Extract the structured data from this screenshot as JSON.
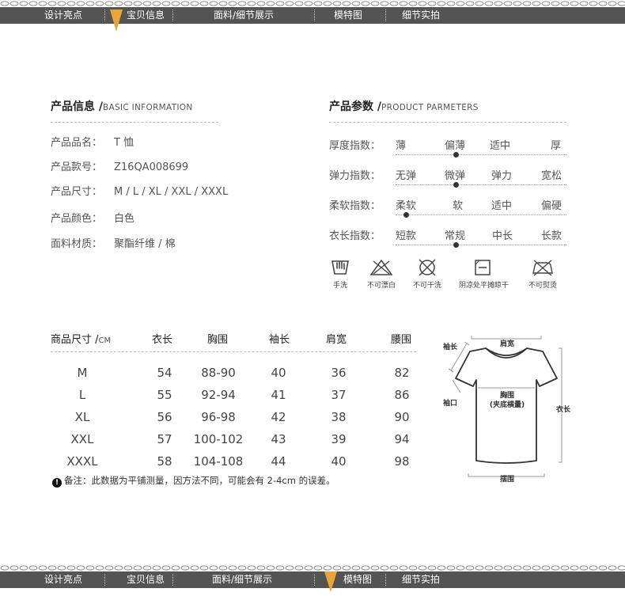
{
  "nav": {
    "items": [
      "设计亮点",
      "宝贝信息",
      "面料/细节展示",
      "模特图",
      "细节实拍"
    ],
    "top_active": 1,
    "bottom_active": 3,
    "colors": {
      "bar": "#545454",
      "arrow": "#e9a53a"
    }
  },
  "product_info": {
    "title": "产品信息 /",
    "title_en": "BASIC INFORMATION",
    "rows": [
      {
        "label": "产品品名：",
        "value": "T 恤"
      },
      {
        "label": "产品款号：",
        "value": "Z16QA008699"
      },
      {
        "label": "产品尺寸：",
        "value": "M / L / XL / XXL / XXXL"
      },
      {
        "label": "产品颜色：",
        "value": "白色"
      },
      {
        "label": "面料材质：",
        "value": "聚酯纤维 / 棉"
      }
    ]
  },
  "product_params": {
    "title": "产品参数 /",
    "title_en": "PRODUCT PARMETERS",
    "rows": [
      {
        "label": "厚度指数：",
        "options": [
          "薄",
          "偏薄",
          "适中",
          "厚"
        ],
        "selected_fraction": 0.35
      },
      {
        "label": "弹力指数：",
        "options": [
          "无弹",
          "微弹",
          "弹力",
          "宽松"
        ],
        "selected_fraction": 0.35
      },
      {
        "label": "柔软指数：",
        "options": [
          "柔软",
          "软",
          "适中",
          "偏硬"
        ],
        "selected_fraction": 0.06
      },
      {
        "label": "衣长指数：",
        "options": [
          "短款",
          "常规",
          "中长",
          "长款"
        ],
        "selected_fraction": 0.35
      }
    ],
    "care": [
      {
        "icon": "hand-wash-icon",
        "label": "手洗"
      },
      {
        "icon": "no-bleach-icon",
        "label": "不可漂白"
      },
      {
        "icon": "no-dry-clean-icon",
        "label": "不可干洗"
      },
      {
        "icon": "shade-dry-flat-icon",
        "label": "阴凉处平摊晾干"
      },
      {
        "icon": "no-iron-icon",
        "label": "不可熨烫"
      }
    ]
  },
  "size_table": {
    "headers": [
      "商品尺寸 /",
      "衣长",
      "胸围",
      "袖长",
      "肩宽",
      "腰围"
    ],
    "unit": "CM",
    "rows": [
      [
        "M",
        "54",
        "88-90",
        "40",
        "36",
        "82"
      ],
      [
        "L",
        "55",
        "92-94",
        "41",
        "37",
        "86"
      ],
      [
        "XL",
        "56",
        "96-98",
        "42",
        "38",
        "90"
      ],
      [
        "XXL",
        "57",
        "100-102",
        "43",
        "39",
        "94"
      ],
      [
        "XXXL",
        "58",
        "104-108",
        "44",
        "40",
        "98"
      ]
    ],
    "note": "备注：此数据为平铺测量，因方法不同，可能会有 2-4cm 的误差。",
    "note_icon": "!"
  },
  "diagram": {
    "labels": {
      "shoulder": "肩宽",
      "sleeve": "袖长",
      "cuff": "袖口",
      "chest_1": "胸围",
      "chest_2": "(夹底横量)",
      "length": "衣长",
      "hem": "摆围"
    }
  }
}
